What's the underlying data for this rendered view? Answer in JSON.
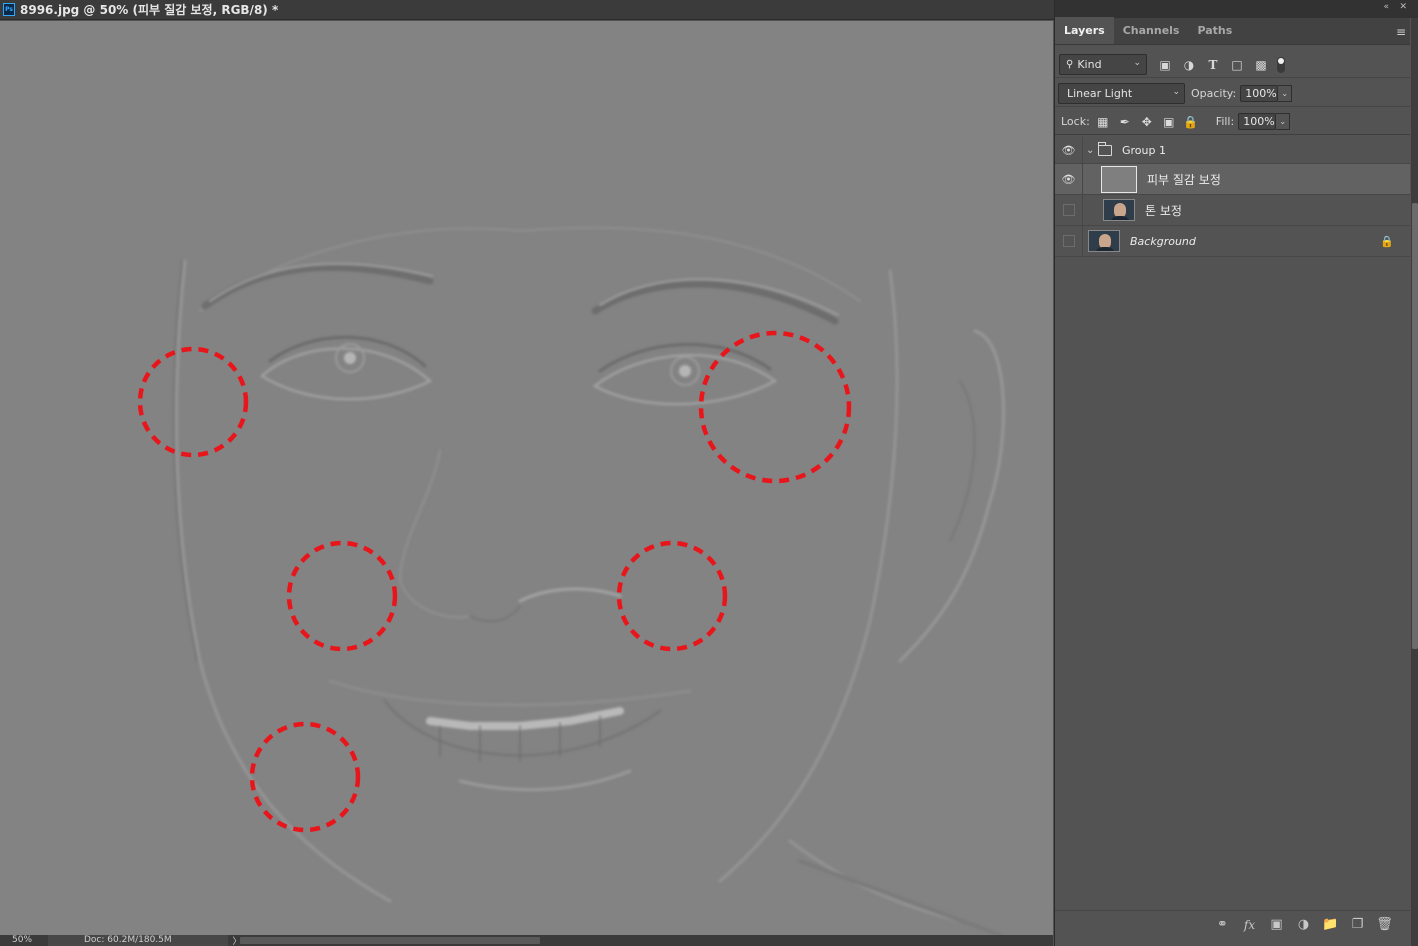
{
  "document": {
    "app_badge": "Ps",
    "title": "8996.jpg @ 50% (피부 질감 보정, RGB/8) *"
  },
  "status_bar": {
    "zoom": "50%",
    "doc_info": "Doc: 60.2M/180.5M",
    "arrow": "〉"
  },
  "panel": {
    "collapse_label": "«",
    "close_label": "✕",
    "tabs": [
      {
        "label": "Layers",
        "active": true
      },
      {
        "label": "Channels",
        "active": false
      },
      {
        "label": "Paths",
        "active": false
      }
    ],
    "menu_icon": "≡",
    "filter": {
      "kind_label": "Kind",
      "filter_icons": [
        "image-filter-icon",
        "adjustment-filter-icon",
        "type-filter-icon",
        "shape-filter-icon",
        "smart-object-filter-icon"
      ]
    },
    "blend_mode": "Linear Light",
    "opacity_label": "Opacity:",
    "opacity_value": "100%",
    "lock_label": "Lock:",
    "fill_label": "Fill:",
    "fill_value": "100%",
    "layers": [
      {
        "name": "Group 1",
        "type": "group",
        "visible": true,
        "expanded": true
      },
      {
        "name": "피부 질감 보정",
        "type": "pixel",
        "visible": true,
        "selected": true,
        "indented": true
      },
      {
        "name": "톤 보정",
        "type": "pixel",
        "visible": false,
        "indented": true
      },
      {
        "name": "Background",
        "type": "background",
        "visible": false,
        "locked": true
      }
    ],
    "footer_icons": [
      "link-icon",
      "fx-icon",
      "mask-icon",
      "adjustment-icon",
      "new-group-icon",
      "new-layer-icon",
      "trash-icon"
    ]
  },
  "annotations": {
    "circle_color": "#e8161b",
    "circle_count": 5
  }
}
